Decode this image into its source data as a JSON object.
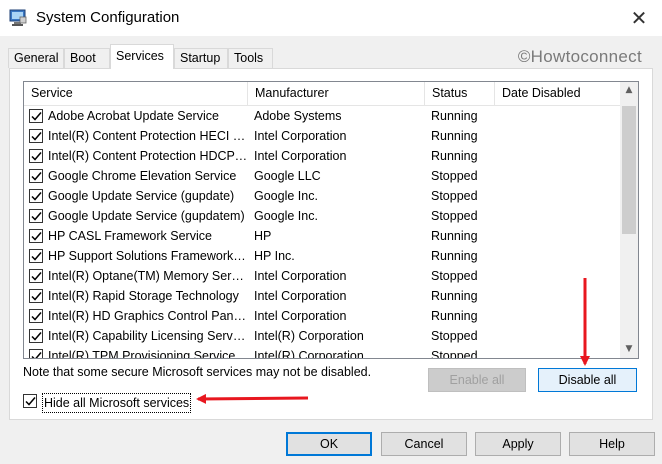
{
  "window": {
    "title": "System Configuration",
    "close_glyph": "✕",
    "icon": "msconfig-computer-icon"
  },
  "tabs": [
    {
      "label": "General",
      "active": false
    },
    {
      "label": "Boot",
      "active": false
    },
    {
      "label": "Services",
      "active": true
    },
    {
      "label": "Startup",
      "active": false
    },
    {
      "label": "Tools",
      "active": false
    }
  ],
  "watermark": "©Howtoconnect",
  "services_list": {
    "columns": [
      "Service",
      "Manufacturer",
      "Status",
      "Date Disabled"
    ],
    "rows": [
      {
        "service": "Adobe Acrobat Update Service",
        "manufacturer": "Adobe Systems",
        "status": "Running",
        "date_disabled": "",
        "checked": true
      },
      {
        "service": "Intel(R) Content Protection HECI Service",
        "manufacturer": "Intel Corporation",
        "status": "Running",
        "date_disabled": "",
        "checked": true
      },
      {
        "service": "Intel(R) Content Protection HDCP Service",
        "manufacturer": "Intel Corporation",
        "status": "Running",
        "date_disabled": "",
        "checked": true
      },
      {
        "service": "Google Chrome Elevation Service",
        "manufacturer": "Google LLC",
        "status": "Stopped",
        "date_disabled": "",
        "checked": true
      },
      {
        "service": "Google Update Service (gupdate)",
        "manufacturer": "Google Inc.",
        "status": "Stopped",
        "date_disabled": "",
        "checked": true
      },
      {
        "service": "Google Update Service (gupdatem)",
        "manufacturer": "Google Inc.",
        "status": "Stopped",
        "date_disabled": "",
        "checked": true
      },
      {
        "service": "HP CASL Framework Service",
        "manufacturer": "HP",
        "status": "Running",
        "date_disabled": "",
        "checked": true
      },
      {
        "service": "HP Support Solutions Framework Service",
        "manufacturer": "HP Inc.",
        "status": "Running",
        "date_disabled": "",
        "checked": true
      },
      {
        "service": "Intel(R) Optane(TM) Memory Service",
        "manufacturer": "Intel Corporation",
        "status": "Stopped",
        "date_disabled": "",
        "checked": true
      },
      {
        "service": "Intel(R) Rapid Storage Technology",
        "manufacturer": "Intel Corporation",
        "status": "Running",
        "date_disabled": "",
        "checked": true
      },
      {
        "service": "Intel(R) HD Graphics Control Panel Service",
        "manufacturer": "Intel Corporation",
        "status": "Running",
        "date_disabled": "",
        "checked": true
      },
      {
        "service": "Intel(R) Capability Licensing Service",
        "manufacturer": "Intel(R) Corporation",
        "status": "Stopped",
        "date_disabled": "",
        "checked": true
      },
      {
        "service": "Intel(R) TPM Provisioning Service",
        "manufacturer": "Intel(R) Corporation",
        "status": "Stopped",
        "date_disabled": "",
        "checked": true
      }
    ]
  },
  "note": "Note that some secure Microsoft services may not be disabled.",
  "buttons": {
    "enable_all": "Enable all",
    "disable_all": "Disable all",
    "ok": "OK",
    "cancel": "Cancel",
    "apply": "Apply",
    "help": "Help"
  },
  "hide_ms": {
    "label": "Hide all Microsoft services",
    "checked": true
  },
  "colors": {
    "annotation_arrow": "#e8171f",
    "focus_blue": "#0078d7"
  }
}
